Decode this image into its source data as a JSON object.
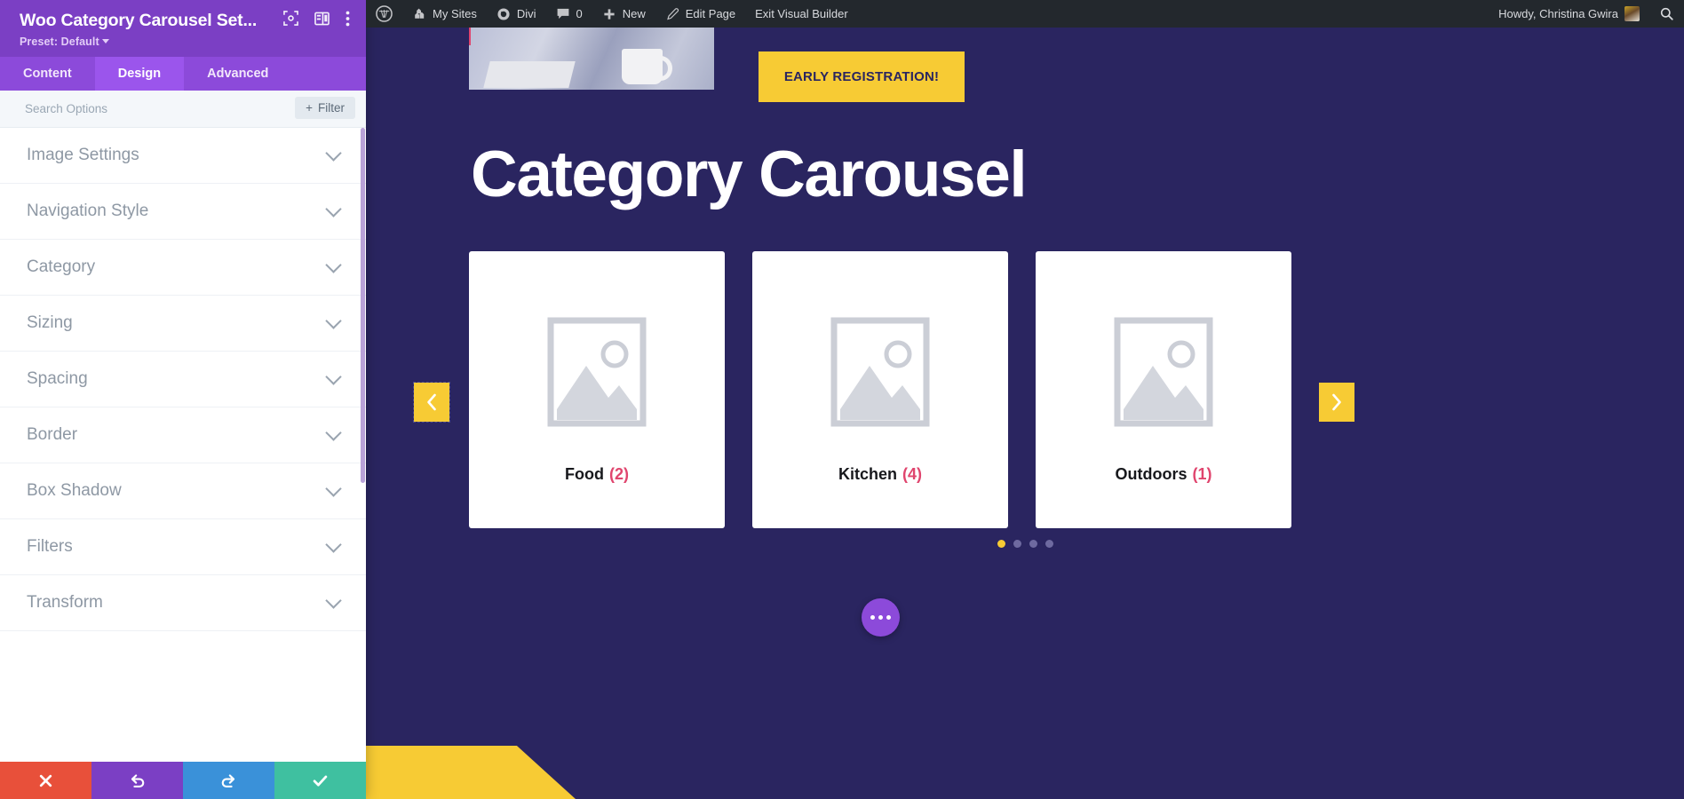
{
  "settings_panel": {
    "title": "Woo Category Carousel Set...",
    "preset_label": "Preset: Default",
    "header_icons": [
      {
        "name": "focus-target-icon"
      },
      {
        "name": "layout-columns-icon"
      },
      {
        "name": "more-vertical-icon"
      }
    ],
    "tabs": [
      {
        "label": "Content",
        "active": false
      },
      {
        "label": "Design",
        "active": true
      },
      {
        "label": "Advanced",
        "active": false
      }
    ],
    "search": {
      "value": "",
      "placeholder": "Search Options",
      "filter_label": "Filter",
      "filter_plus": "+"
    },
    "options": [
      {
        "label": "Image Settings"
      },
      {
        "label": "Navigation Style"
      },
      {
        "label": "Category"
      },
      {
        "label": "Sizing"
      },
      {
        "label": "Spacing"
      },
      {
        "label": "Border"
      },
      {
        "label": "Box Shadow"
      },
      {
        "label": "Filters"
      },
      {
        "label": "Transform"
      }
    ],
    "actions": [
      {
        "name": "discard-button",
        "icon": "close-icon",
        "color": "#e8503a"
      },
      {
        "name": "undo-button",
        "icon": "undo-icon",
        "color": "#7b3fc4"
      },
      {
        "name": "redo-button",
        "icon": "redo-icon",
        "color": "#3a91d9"
      },
      {
        "name": "save-button",
        "icon": "check-icon",
        "color": "#3fc0a0"
      }
    ]
  },
  "adminbar": {
    "wp_logo": "wordpress-logo-icon",
    "items": [
      {
        "label": "My Sites",
        "icon": "sites-icon"
      },
      {
        "label": "Divi",
        "icon": "divi-icon"
      },
      {
        "label": "0",
        "icon": "comment-icon"
      },
      {
        "label": "New",
        "icon": "plus-icon"
      },
      {
        "label": "Edit Page",
        "icon": "pencil-icon"
      },
      {
        "label": "Exit Visual Builder",
        "icon": ""
      }
    ],
    "greeting": "Howdy, Christina Gwira",
    "avatar": "user-avatar",
    "search_icon": "search-icon"
  },
  "canvas": {
    "cta_button": "EARLY REGISTRATION!",
    "heading": "Category Carousel",
    "cards": [
      {
        "name": "Food",
        "count": "(2)"
      },
      {
        "name": "Kitchen",
        "count": "(4)"
      },
      {
        "name": "Outdoors",
        "count": "(1)"
      }
    ],
    "prev_arrow": "chevron-left-icon",
    "next_arrow": "chevron-right-icon",
    "dots": [
      {
        "active": true
      },
      {
        "active": false
      },
      {
        "active": false
      },
      {
        "active": false
      }
    ],
    "fab": "more-options-icon",
    "colors": {
      "accent_yellow": "#f7cb34",
      "background_indigo": "#2a2560",
      "count_pink": "#e0456e",
      "panel_purple": "#7b3fc4"
    }
  }
}
